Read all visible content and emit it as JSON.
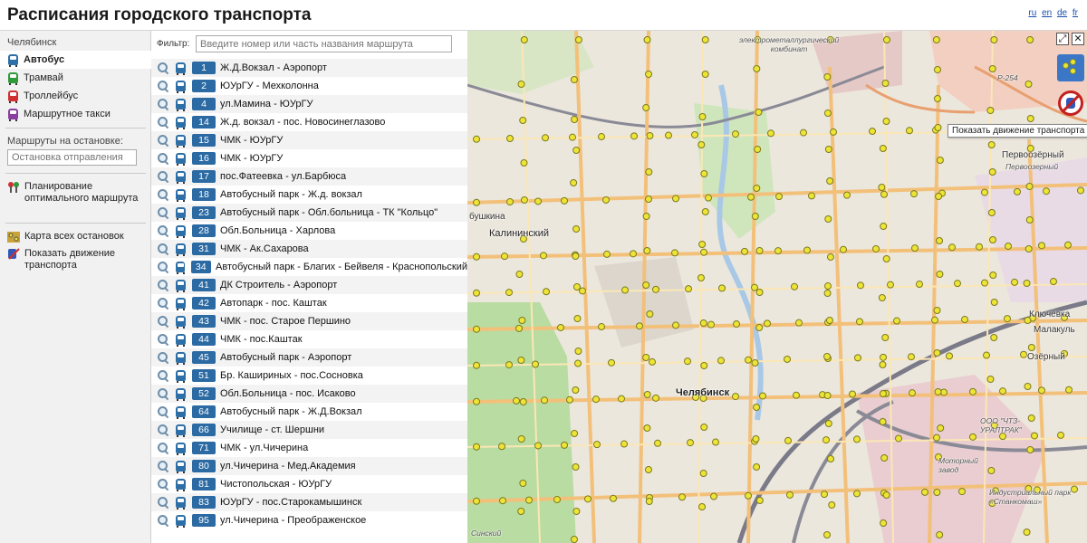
{
  "header": {
    "title": "Расписания городского транспорта",
    "languages": [
      "ru",
      "en",
      "de",
      "fr"
    ]
  },
  "sidebar": {
    "city": "Челябинск",
    "transport_types": [
      {
        "label": "Автобус",
        "icon": "bus-icon",
        "color": "#2d6fa6",
        "active": true
      },
      {
        "label": "Трамвай",
        "icon": "tram-icon",
        "color": "#2e9a3a",
        "active": false
      },
      {
        "label": "Троллейбус",
        "icon": "trolleybus-icon",
        "color": "#d03030",
        "active": false
      },
      {
        "label": "Маршрутное такси",
        "icon": "minibus-icon",
        "color": "#8a3fa0",
        "active": false
      }
    ],
    "stop_routes_label": "Маршруты на остановке:",
    "stop_input_placeholder": "Остановка отправления",
    "planning_label": "Планирование оптимального маршрута",
    "all_stops_label": "Карта всех остановок",
    "show_movement_label": "Показать движение транспорта"
  },
  "route_list": {
    "filter_label": "Фильтр:",
    "filter_placeholder": "Введите номер или часть названия маршрута",
    "routes": [
      {
        "number": "1",
        "name": "Ж.Д.Вокзал - Аэропорт"
      },
      {
        "number": "2",
        "name": "ЮУрГУ - Мехколонна"
      },
      {
        "number": "4",
        "name": "ул.Мамина - ЮУрГУ"
      },
      {
        "number": "14",
        "name": "Ж.д. вокзал - пос. Новосинеглазово"
      },
      {
        "number": "15",
        "name": "ЧМК - ЮУрГУ"
      },
      {
        "number": "16",
        "name": "ЧМК - ЮУрГУ"
      },
      {
        "number": "17",
        "name": "пос.Фатеевка - ул.Барбюса"
      },
      {
        "number": "18",
        "name": "Автобусный парк - Ж.д. вокзал"
      },
      {
        "number": "23",
        "name": "Автобусный парк - Обл.больница - ТК \"Кольцо\""
      },
      {
        "number": "28",
        "name": "Обл.Больница - Харлова"
      },
      {
        "number": "31",
        "name": "ЧМК - Ак.Сахарова"
      },
      {
        "number": "34",
        "name": "Автобусный парк - Благих - Бейвеля - Краснопольский"
      },
      {
        "number": "41",
        "name": "ДК Строитель - Аэропорт"
      },
      {
        "number": "42",
        "name": "Автопарк - пос. Каштак"
      },
      {
        "number": "43",
        "name": "ЧМК - пос. Старое Першино"
      },
      {
        "number": "44",
        "name": "ЧМК - пос.Каштак"
      },
      {
        "number": "45",
        "name": "Автобусный парк - Аэропорт"
      },
      {
        "number": "51",
        "name": "Бр. Кашириных - пос.Сосновка"
      },
      {
        "number": "52",
        "name": "Обл.Больница - пос. Исаково"
      },
      {
        "number": "64",
        "name": "Автобусный парк - Ж.Д.Вокзал"
      },
      {
        "number": "66",
        "name": "Училище - ст. Шершни"
      },
      {
        "number": "71",
        "name": "ЧМК - ул.Чичерина"
      },
      {
        "number": "80",
        "name": "ул.Чичерина - Мед.Академия"
      },
      {
        "number": "81",
        "name": "Чистопольская - ЮУрГУ"
      },
      {
        "number": "83",
        "name": "ЮУрГУ - пос.Старокамышинск"
      },
      {
        "number": "95",
        "name": "ул.Чичерина - Преображенское"
      }
    ]
  },
  "map": {
    "tooltip": "Показать движение транспорта",
    "controls": [
      "⤢",
      "✕"
    ],
    "labels": {
      "electrometallurgical": "электрометаллургический комбинат",
      "p254": "Р-254",
      "pervoozerny": "Первоозёрный",
      "pervoozerny_small": "Первоозерный",
      "kalininsky": "Калининский",
      "bushkina": "бушкина",
      "chelyabinsk": "Челябинск",
      "klyuchevka": "Ключёвка",
      "malakul": "Малакуль",
      "ozerny": "Озёрный",
      "chtz": "ООО \"ЧТЗ-УРАЛТРАК\"",
      "motor_zavod": "Моторный завод",
      "industrial_park": "Индустриальный парк «Станкомаш»",
      "sinsky": "Синский"
    }
  }
}
